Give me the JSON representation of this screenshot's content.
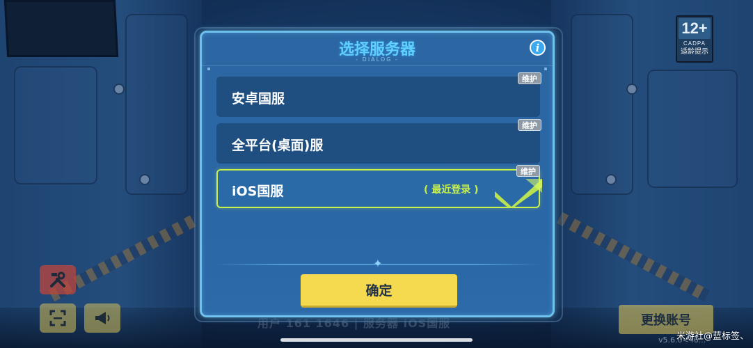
{
  "dialog": {
    "title": "选择服务器",
    "subtitle": "- DIALOG -",
    "info_icon": "i",
    "servers": [
      {
        "name": "安卓国服",
        "status_badge": "维护",
        "recent_label": "",
        "selected": false
      },
      {
        "name": "全平台(桌面)服",
        "status_badge": "维护",
        "recent_label": "",
        "selected": false
      },
      {
        "name": "iOS国服",
        "status_badge": "维护",
        "recent_label": "( 最近登录 )",
        "selected": true
      }
    ],
    "confirm_label": "确定"
  },
  "age_rating": {
    "age": "12+",
    "org": "CADPA",
    "tip": "适龄提示"
  },
  "bottom_bar": {
    "info_text": "用户 161    1646 | 服务器 iOS国服",
    "switch_account_label": "更换账号",
    "version": "v5.6.0<46..."
  },
  "watermark": "米游社@蓝标签、",
  "icons": {
    "tools": "tools-icon",
    "scan": "scan-icon",
    "announcement": "megaphone-icon",
    "selected": "checkmark-icon"
  },
  "colors": {
    "title": "#5fd0ff",
    "accent_green": "#c8f04a",
    "confirm_button": "#f5d94e",
    "dialog_border": "#6fc2ee",
    "maintenance_badge": "#8e9aa6"
  }
}
